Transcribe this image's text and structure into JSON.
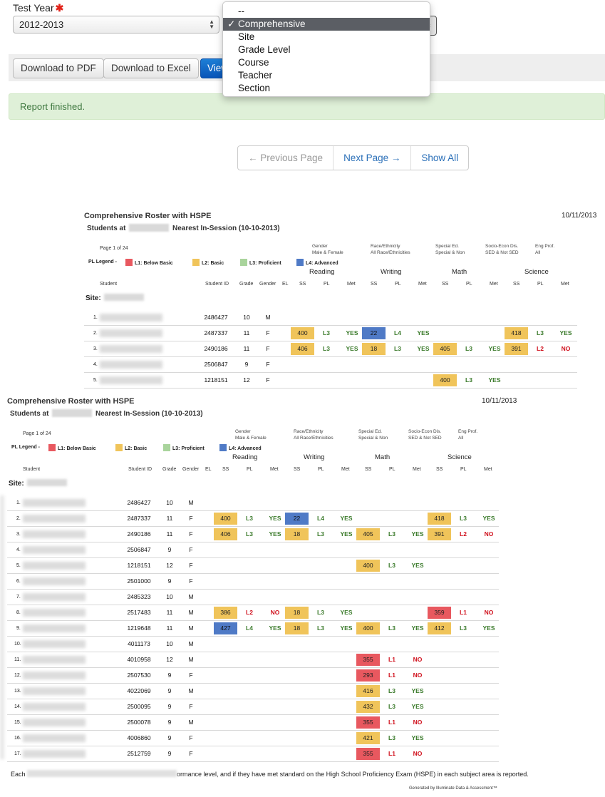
{
  "form": {
    "test_year_label": "Test Year",
    "test_year_value": "2012-2013",
    "report_by_options": [
      "--",
      "Comprehensive",
      "Site",
      "Grade Level",
      "Course",
      "Teacher",
      "Section"
    ],
    "report_by_selected": "Comprehensive",
    "check_glyph": "✓"
  },
  "toolbar": {
    "pdf_label": "Download to PDF",
    "excel_label": "Download to Excel",
    "view_label": "View"
  },
  "alert": {
    "text": "Report finished."
  },
  "pager": {
    "prev": "← Previous Page",
    "next": "Next Page →",
    "all": "Show All"
  },
  "report": {
    "title": "Comprehensive Roster with HSPE",
    "subtitle_prefix": "Students at",
    "subtitle_suffix": "Nearest In-Session (10-10-2013)",
    "date": "10/11/2013",
    "page": "Page 1 of 24",
    "filters": [
      {
        "label": "Gender",
        "value": "Male & Female"
      },
      {
        "label": "Race/Ethnicity",
        "value": "All Race/Ethnicities"
      },
      {
        "label": "Special Ed.",
        "value": "Special & Non"
      },
      {
        "label": "Socio-Econ Dis.",
        "value": "SED & Not SED"
      },
      {
        "label": "Eng Prof.",
        "value": "All"
      }
    ],
    "legend_label": "PL Legend -",
    "legend": [
      {
        "label": "L1: Below Basic",
        "color": "#e8585f"
      },
      {
        "label": "L2: Basic",
        "color": "#f0c45a"
      },
      {
        "label": "L3: Proficient",
        "color": "#a9d49c"
      },
      {
        "label": "L4: Advanced",
        "color": "#4f7ac6"
      }
    ],
    "subjects": [
      "Reading",
      "Writing",
      "Math",
      "Science"
    ],
    "columns": {
      "student": "Student",
      "student_id": "Student ID",
      "grade": "Grade",
      "gender": "Gender",
      "el": "EL",
      "ss": "SS",
      "pl": "PL",
      "met": "Met"
    },
    "site_label": "Site:",
    "rows": [
      {
        "n": "1.",
        "id": "2486427",
        "grade": "10",
        "gender": "M",
        "scores": [
          null,
          null,
          null,
          null
        ]
      },
      {
        "n": "2.",
        "id": "2487337",
        "grade": "11",
        "gender": "F",
        "scores": [
          {
            "ss": "400",
            "pl": "L3",
            "met": "YES",
            "c": "L2"
          },
          {
            "ss": "22",
            "pl": "L4",
            "met": "YES",
            "c": "L4"
          },
          null,
          {
            "ss": "418",
            "pl": "L3",
            "met": "YES",
            "c": "L2"
          }
        ]
      },
      {
        "n": "3.",
        "id": "2490186",
        "grade": "11",
        "gender": "F",
        "scores": [
          {
            "ss": "406",
            "pl": "L3",
            "met": "YES",
            "c": "L2"
          },
          {
            "ss": "18",
            "pl": "L3",
            "met": "YES",
            "c": "L2"
          },
          {
            "ss": "405",
            "pl": "L3",
            "met": "YES",
            "c": "L2"
          },
          {
            "ss": "391",
            "pl": "L2",
            "met": "NO",
            "c": "L2"
          }
        ]
      },
      {
        "n": "4.",
        "id": "2506847",
        "grade": "9",
        "gender": "F",
        "scores": [
          null,
          null,
          null,
          null
        ]
      },
      {
        "n": "5.",
        "id": "1218151",
        "grade": "12",
        "gender": "F",
        "scores": [
          null,
          null,
          {
            "ss": "400",
            "pl": "L3",
            "met": "YES",
            "c": "L2"
          },
          null
        ]
      },
      {
        "n": "6.",
        "id": "2501000",
        "grade": "9",
        "gender": "F",
        "scores": [
          null,
          null,
          null,
          null
        ]
      },
      {
        "n": "7.",
        "id": "2485323",
        "grade": "10",
        "gender": "M",
        "scores": [
          null,
          null,
          null,
          null
        ]
      },
      {
        "n": "8.",
        "id": "2517483",
        "grade": "11",
        "gender": "M",
        "scores": [
          {
            "ss": "386",
            "pl": "L2",
            "met": "NO",
            "c": "L2"
          },
          {
            "ss": "18",
            "pl": "L3",
            "met": "YES",
            "c": "L2"
          },
          null,
          {
            "ss": "359",
            "pl": "L1",
            "met": "NO",
            "c": "L1"
          }
        ]
      },
      {
        "n": "9.",
        "id": "1219648",
        "grade": "11",
        "gender": "M",
        "scores": [
          {
            "ss": "427",
            "pl": "L4",
            "met": "YES",
            "c": "L4"
          },
          {
            "ss": "18",
            "pl": "L3",
            "met": "YES",
            "c": "L2"
          },
          {
            "ss": "400",
            "pl": "L3",
            "met": "YES",
            "c": "L2"
          },
          {
            "ss": "412",
            "pl": "L3",
            "met": "YES",
            "c": "L2"
          }
        ]
      },
      {
        "n": "10.",
        "id": "4011173",
        "grade": "10",
        "gender": "M",
        "scores": [
          null,
          null,
          null,
          null
        ]
      },
      {
        "n": "11.",
        "id": "4010958",
        "grade": "12",
        "gender": "M",
        "scores": [
          null,
          null,
          {
            "ss": "355",
            "pl": "L1",
            "met": "NO",
            "c": "L1"
          },
          null
        ]
      },
      {
        "n": "12.",
        "id": "2507530",
        "grade": "9",
        "gender": "F",
        "scores": [
          null,
          null,
          {
            "ss": "293",
            "pl": "L1",
            "met": "NO",
            "c": "L1"
          },
          null
        ]
      },
      {
        "n": "13.",
        "id": "4022069",
        "grade": "9",
        "gender": "M",
        "scores": [
          null,
          null,
          {
            "ss": "416",
            "pl": "L3",
            "met": "YES",
            "c": "L2"
          },
          null
        ]
      },
      {
        "n": "14.",
        "id": "2500095",
        "grade": "9",
        "gender": "F",
        "scores": [
          null,
          null,
          {
            "ss": "432",
            "pl": "L3",
            "met": "YES",
            "c": "L2"
          },
          null
        ]
      },
      {
        "n": "15.",
        "id": "2500078",
        "grade": "9",
        "gender": "M",
        "scores": [
          null,
          null,
          {
            "ss": "355",
            "pl": "L1",
            "met": "NO",
            "c": "L1"
          },
          null
        ]
      },
      {
        "n": "16.",
        "id": "4006860",
        "grade": "9",
        "gender": "F",
        "scores": [
          null,
          null,
          {
            "ss": "421",
            "pl": "L3",
            "met": "YES",
            "c": "L2"
          },
          null
        ]
      },
      {
        "n": "17.",
        "id": "2512759",
        "grade": "9",
        "gender": "F",
        "scores": [
          null,
          null,
          {
            "ss": "355",
            "pl": "L1",
            "met": "NO",
            "c": "L1"
          },
          null
        ]
      }
    ],
    "footer_prefix": "Each",
    "footer_suffix": "ormance level, and if they have met standard on the High School Proficiency Exam (HSPE) in each subject area is reported.",
    "generated": "Generated by Illuminate Data & Assessment™"
  },
  "colors": {
    "L1": "#e8585f",
    "L2": "#f0c45a",
    "L3": "#a9d49c",
    "L4": "#4f7ac6",
    "met_yes": "#3a7a2a",
    "met_no": "#d0101c",
    "pl_default": "#3a7a2a",
    "pl_fail": "#d0101c"
  }
}
